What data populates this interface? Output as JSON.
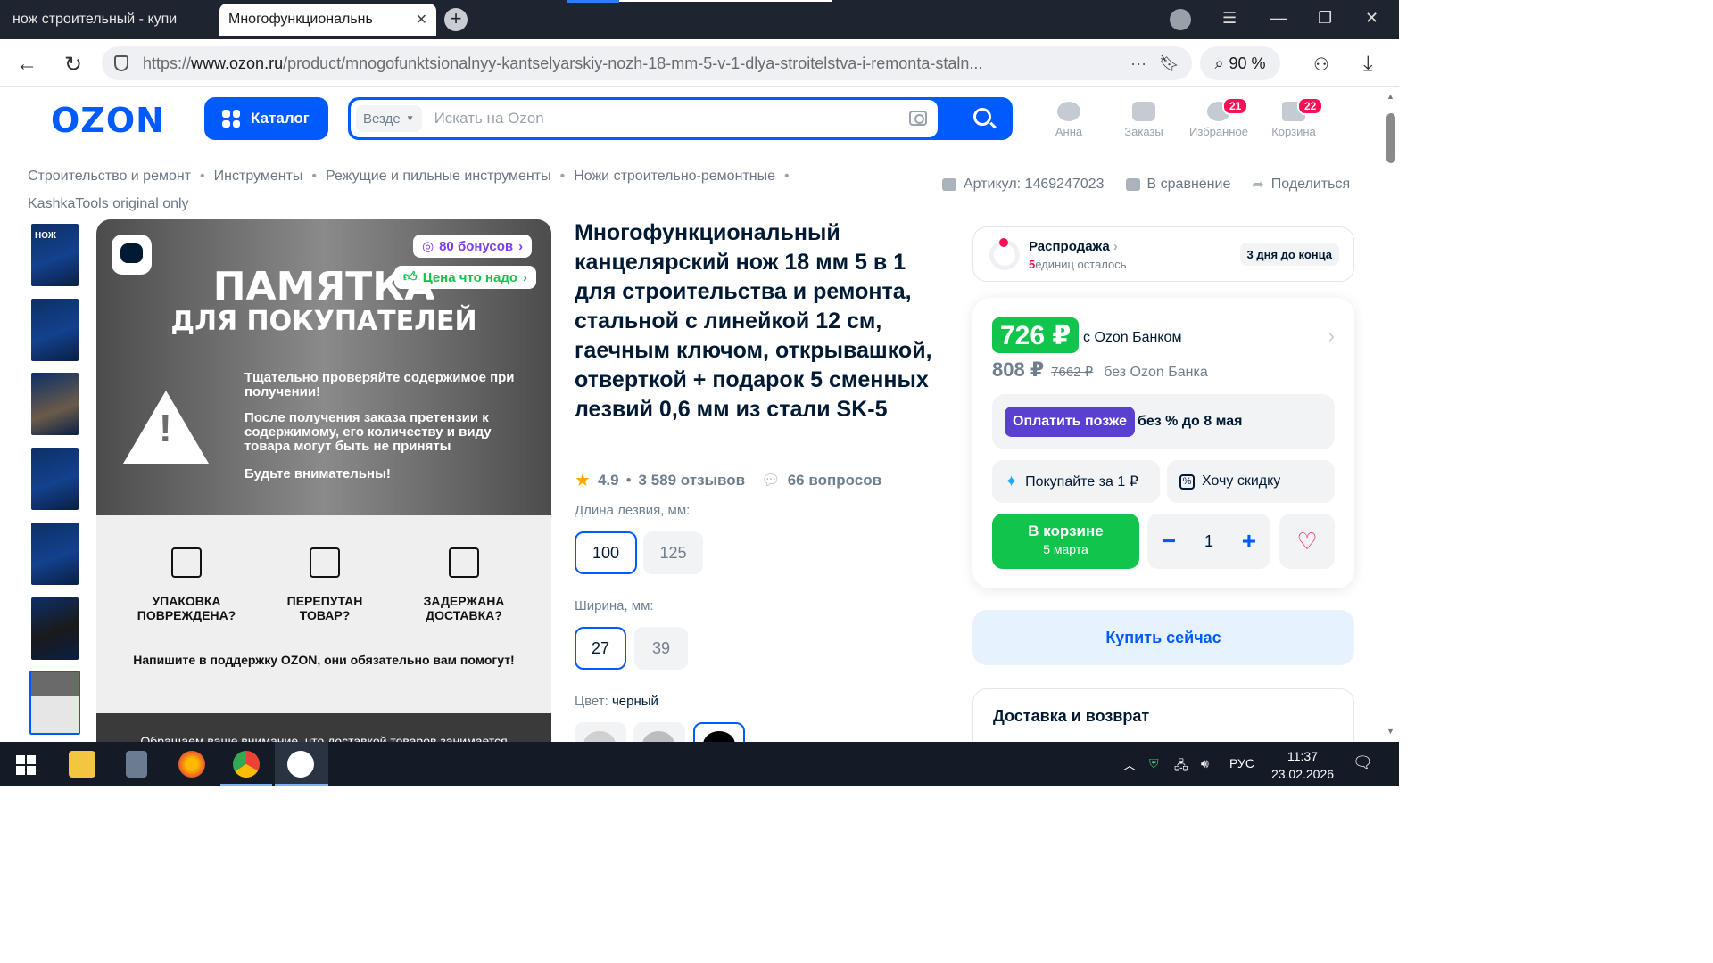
{
  "browser": {
    "tabs": [
      {
        "title": "нож строительный - купи"
      },
      {
        "title": "Многофункциональнь"
      }
    ],
    "url_prefix": "https://",
    "url_domain": "www.ozon.ru",
    "url_path": "/product/mnogofunktsionalnyy-kantselyarskiy-nozh-18-mm-5-v-1-dlya-stroitelstva-i-remonta-staln...",
    "zoom": "90 %"
  },
  "header": {
    "logo": "OZON",
    "catalog": "Каталог",
    "search_scope": "Везде",
    "search_placeholder": "Искать на Ozon",
    "user": "Анна",
    "orders": "Заказы",
    "favorites": "Избранное",
    "favorites_count": "21",
    "cart": "Корзина",
    "cart_count": "22"
  },
  "breadcrumbs": [
    "Строительство и ремонт",
    "Инструменты",
    "Режущие и пильные инструменты",
    "Ножи строительно-ремонтные",
    "KashkaTools original only"
  ],
  "meta": {
    "article": "Артикул: 1469247023",
    "compare": "В сравнение",
    "share": "Поделиться"
  },
  "gallery": {
    "bonus": "80 бонусов",
    "price_ok": "Цена что надо",
    "memo_title": "ПАМЯТКА",
    "memo_sub": "ДЛЯ ПОКУПАТЕЛЕЙ",
    "p1": "Тщательно проверяйте содержимое при получении!",
    "p2": "После получения заказа претензии к содержимому, его количеству и виду товара могут быть не приняты",
    "p3": "Будьте внимательны!",
    "issues": [
      "УПАКОВКА ПОВРЕЖДЕНА?",
      "ПЕРЕПУТАН ТОВАР?",
      "ЗАДЕРЖАНА ДОСТАВКА?"
    ],
    "support": "Напишите в поддержку OZON, они обязательно вам помогут!",
    "bottom": "Обращаем ваше внимание, что доставкой товаров занимается",
    "thumb1_text": "НОЖ"
  },
  "product": {
    "title": "Многофункциональный канцелярский нож 18 мм 5 в 1 для строительства и ремонта, стальной с линейкой 12 см, гаечным ключом, открывашкой, отверткой + подарок 5 сменных лезвий 0,6 мм из стали SK-5",
    "rating": "4.9",
    "reviews": "3 589 отзывов",
    "questions": "66 вопросов",
    "blade_label": "Длина лезвия, мм:",
    "blade_options": [
      "100",
      "125"
    ],
    "width_label": "Ширина, мм:",
    "width_options": [
      "27",
      "39"
    ],
    "color_label": "Цвет:",
    "color_value": "черный"
  },
  "sale": {
    "title": "Распродажа",
    "left_count": "5",
    "left_text": "единиц осталось",
    "ends": "3 дня до конца"
  },
  "price": {
    "card_price": "726 ₽",
    "card_note": "с Ozon Банком",
    "price": "808 ₽",
    "old_price": "7662 ₽",
    "price_note": "без Ozon Банка",
    "pay_later": "Оплатить позже",
    "pay_later_note": "без % до 8 мая",
    "buy_for_1": "Покупайте за 1 ₽",
    "want_discount": "Хочу скидку",
    "in_cart": "В корзине",
    "in_cart_date": "5 марта",
    "qty": "1",
    "buy_now": "Купить сейчас",
    "delivery": "Доставка и возврат"
  },
  "taskbar": {
    "lang": "РУС",
    "time": "11:37",
    "date": "23.02.2026"
  }
}
